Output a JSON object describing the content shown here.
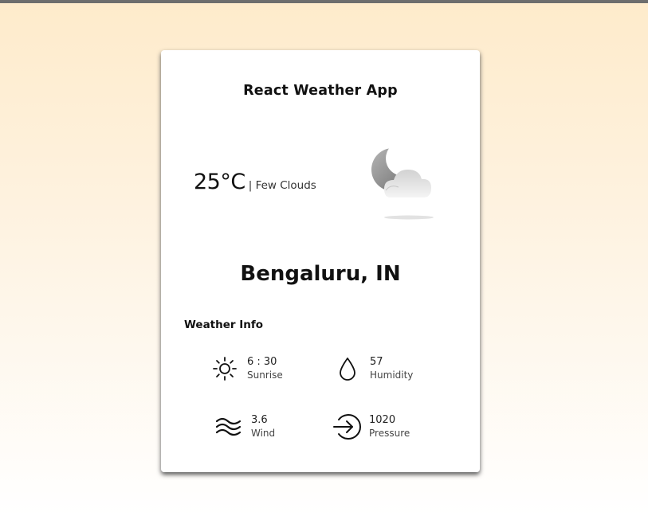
{
  "app": {
    "title": "React Weather App"
  },
  "current": {
    "temperature": "25°C",
    "separator": "|",
    "condition": "Few Clouds",
    "icon": "few-clouds-night-icon"
  },
  "location": {
    "city": "Bengaluru, IN"
  },
  "weather_info": {
    "heading": "Weather Info",
    "items": [
      {
        "value": "6 : 30",
        "label": "Sunrise",
        "icon": "sun-icon"
      },
      {
        "value": "57",
        "label": "Humidity",
        "icon": "water-drop-icon"
      },
      {
        "value": "3.6",
        "label": "Wind",
        "icon": "wind-icon"
      },
      {
        "value": "1020",
        "label": "Pressure",
        "icon": "pressure-arrow-icon"
      }
    ]
  },
  "colors": {
    "card": "#ffffff",
    "background_top": "#feebcb",
    "background_bottom": "#ffffff",
    "text": "#111111"
  }
}
